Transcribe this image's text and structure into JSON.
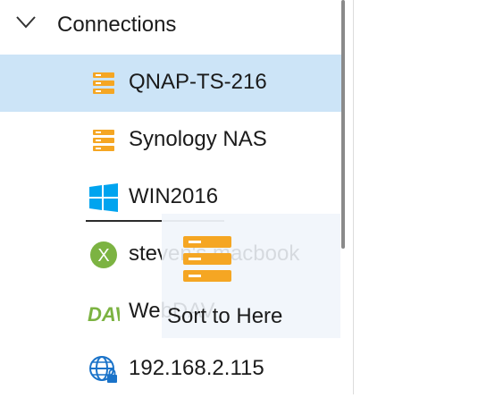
{
  "tree": {
    "header": {
      "label": "Connections",
      "expanded": true
    },
    "items": [
      {
        "label": "QNAP-TS-216",
        "icon": "nas-server-icon",
        "selected": true
      },
      {
        "label": "Synology NAS",
        "icon": "nas-server-icon",
        "selected": false
      },
      {
        "label": "WIN2016",
        "icon": "windows-icon",
        "selected": false
      },
      {
        "label": "steven's macbook",
        "icon": "xbox-x-icon",
        "selected": false
      },
      {
        "label": "WebDAV",
        "icon": "dav-icon",
        "selected": false
      },
      {
        "label": "192.168.2.115",
        "icon": "network-globe-lock-icon",
        "selected": false
      }
    ]
  },
  "drag_ghost": {
    "label": "Sort to Here",
    "icon": "nas-server-icon"
  },
  "colors": {
    "selected_bg": "#cce4f7",
    "nas_orange": "#f5a623",
    "windows_blue": "#00a4ef",
    "x_green": "#7cb342",
    "dav_green": "#7cb342",
    "globe_blue": "#1a73c9"
  }
}
